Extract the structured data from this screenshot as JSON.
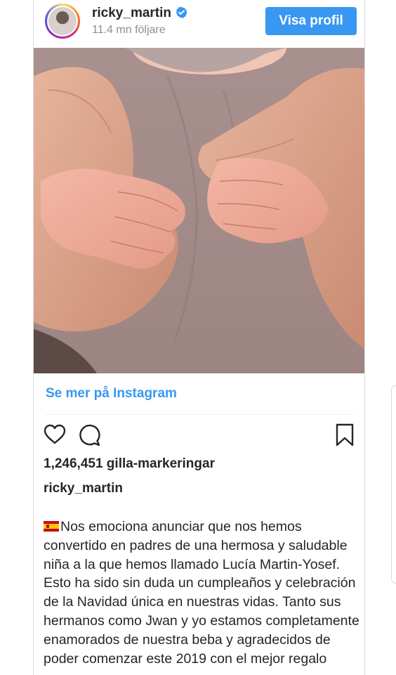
{
  "post": {
    "username": "ricky_martin",
    "followers": "11.4 mn följare",
    "profile_button": "Visa profil",
    "see_more": "Se mer på Instagram",
    "likes": "1,246,451 gilla-markeringar",
    "caption_owner": "ricky_martin",
    "caption_flag": "spain-flag-emoji",
    "caption_text": "Nos emociona anunciar que nos hemos convertido en padres de una hermosa y saludable niña a la que hemos llamado Lucía Martin-Yosef. Esto ha sido sin duda un cumpleaños y celebración de la Navidad única en nuestras vidas. Tanto sus hermanos como Jwan y yo estamos completamente enamorados de nuestra beba y agradecidos de poder comenzar este 2019 con el mejor regalo"
  },
  "icons": {
    "verified": "verified-badge-icon",
    "like": "heart-icon",
    "comment": "comment-bubble-icon",
    "save": "bookmark-icon"
  },
  "colors": {
    "accent": "#3897f0",
    "text": "#262626",
    "secondary_text": "#8e8e8e"
  }
}
